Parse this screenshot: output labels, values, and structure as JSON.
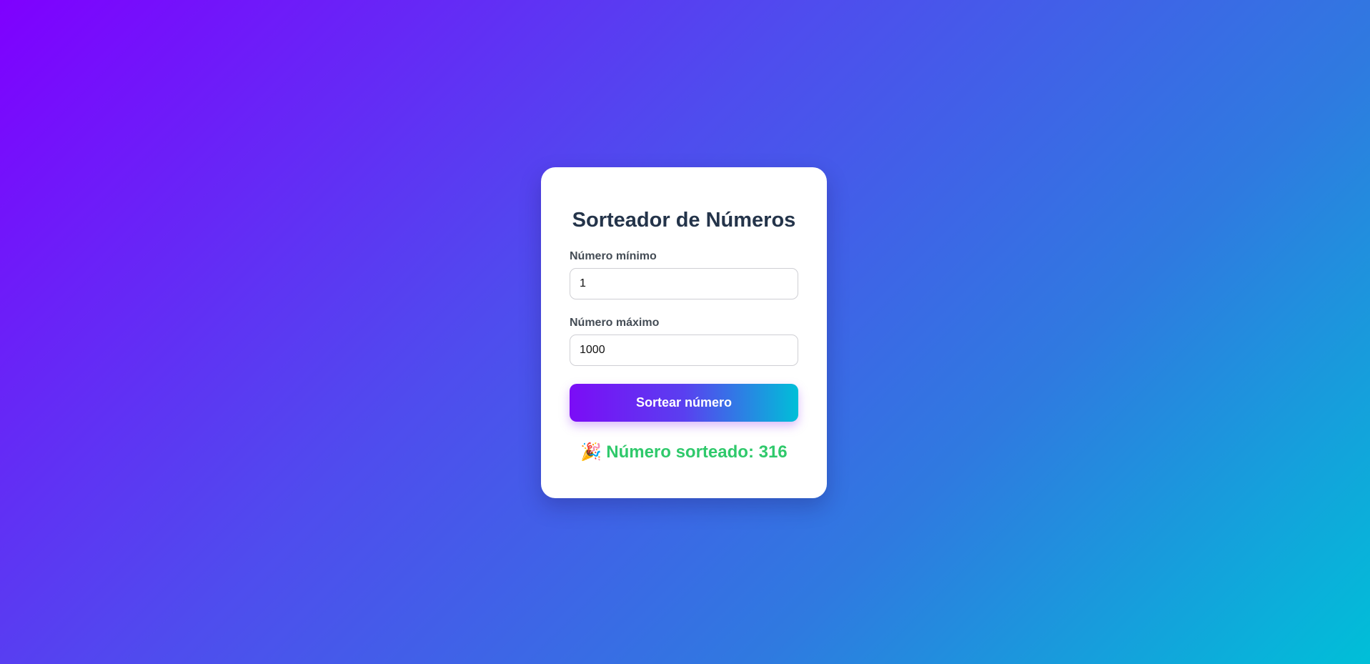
{
  "form": {
    "title": "Sorteador de Números",
    "min_label": "Número mínimo",
    "min_value": "1",
    "max_label": "Número máximo",
    "max_value": "1000",
    "button_label": "Sortear número"
  },
  "result": {
    "icon": "party-popper-icon",
    "icon_glyph": "🎉",
    "text": "Número sorteado: 316"
  },
  "colors": {
    "background_start": "#7f00ff",
    "background_end": "#00bfd8",
    "title": "#24344a",
    "result": "#2fc96b",
    "button_gradient_start": "#7b0cf6",
    "button_gradient_end": "#00bfd8"
  }
}
